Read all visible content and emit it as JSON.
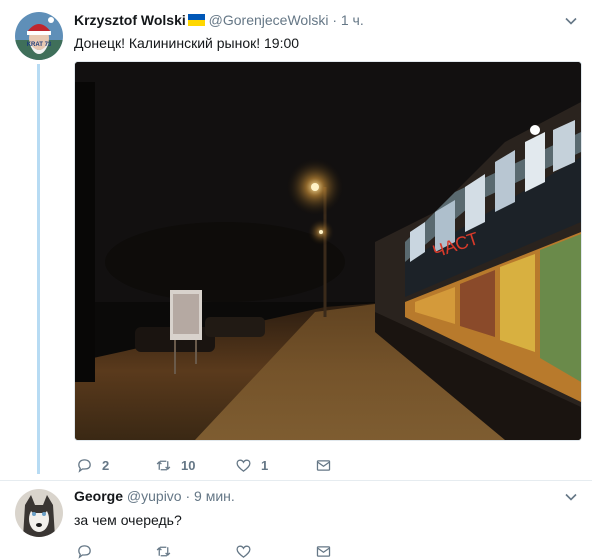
{
  "tweets": [
    {
      "author_name": "Krzysztof Wolski",
      "handle_time": "@GorenjeceWolski · 1 ч.",
      "text": "Донецк! Калининский рынок! 19:00",
      "avatar_caption": "KRAT 73",
      "replies": "2",
      "retweets": "10",
      "likes": "1",
      "flag_colors": [
        "#0057b7",
        "#ffd700"
      ]
    },
    {
      "author_name": "George",
      "handle_time": "@yupivo · 9 мин.",
      "text": "за чем очередь?",
      "replies": "",
      "retweets": "",
      "likes": ""
    }
  ],
  "icons": [
    "chevron-down-icon",
    "reply-icon",
    "retweet-icon",
    "like-icon",
    "direct-message-icon"
  ],
  "colors": {
    "thread_line": "#b7dbf3",
    "muted": "#657786",
    "text": "#14171a"
  }
}
